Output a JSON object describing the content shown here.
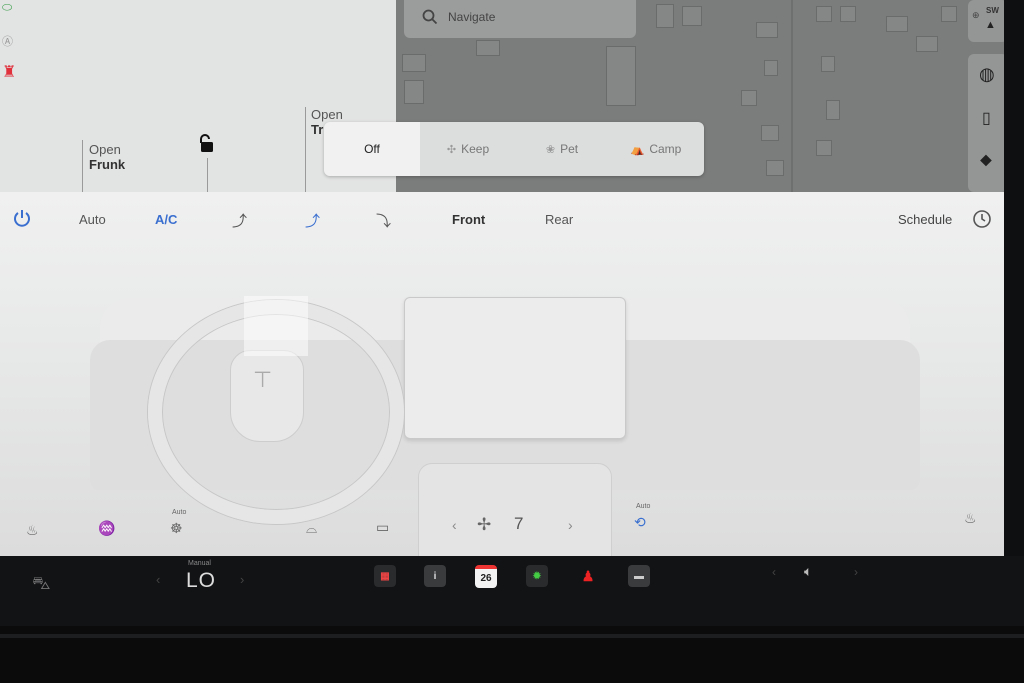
{
  "car_panel": {
    "frunk": {
      "open": "Open",
      "name": "Frunk"
    },
    "trunk": {
      "open": "Open",
      "name": "Tr"
    }
  },
  "map": {
    "search_placeholder": "Navigate",
    "compass": "SW"
  },
  "modes": [
    {
      "label": "Off",
      "active": true
    },
    {
      "label": "Keep",
      "active": false
    },
    {
      "label": "Pet",
      "active": false
    },
    {
      "label": "Camp",
      "active": false
    }
  ],
  "climate": {
    "auto_label": "Auto",
    "ac_label": "A/C",
    "front_label": "Front",
    "rear_label": "Rear",
    "schedule_label": "Schedule",
    "steering_heat_auto": "Auto",
    "recirc_auto": "Auto",
    "fan_speed": "7",
    "accent_color": "#3a6fd0"
  },
  "taskbar": {
    "temp_mode": "Manual",
    "temp_value": "LO",
    "calendar_day": "26"
  }
}
